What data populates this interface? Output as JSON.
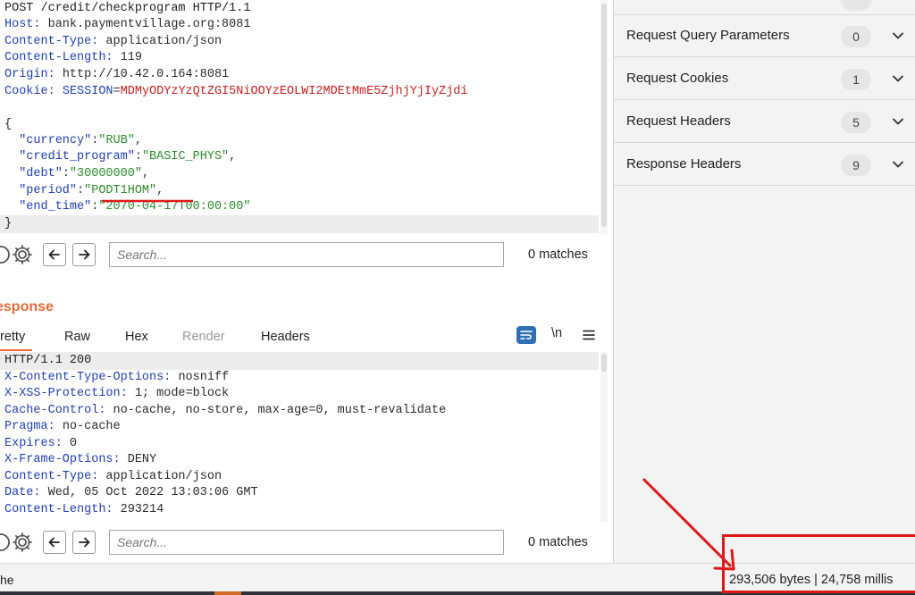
{
  "request": {
    "request_line": "POST /credit/checkprogram HTTP/1.1",
    "headers": [
      {
        "name": "Host",
        "value": "bank.paymentvillage.org:8081"
      },
      {
        "name": "Content-Type",
        "value": "application/json"
      },
      {
        "name": "Content-Length",
        "value": "119"
      },
      {
        "name": "Origin",
        "value": "http://10.42.0.164:8081"
      }
    ],
    "cookie": {
      "name": "Cookie",
      "session_key": "SESSION",
      "session_value": "MDMyODYzYzQtZGI5NiOOYzEOLWI2MDEtMmE5ZjhjYjIyZjdi"
    },
    "body_open": "{",
    "body_fields": [
      {
        "key": "\"currency\"",
        "value": "\"RUB\"",
        "trail": ","
      },
      {
        "key": "\"credit_program\"",
        "value": "\"BASIC_PHYS\"",
        "trail": ","
      },
      {
        "key": "\"debt\"",
        "value": "\"30000000\"",
        "trail": ","
      },
      {
        "key": "\"period\"",
        "value": "\"PODT1HOM\"",
        "trail": ","
      },
      {
        "key": "\"end_time\"",
        "value": "\"2070-04-17T00:00:00\"",
        "trail": ""
      }
    ],
    "body_close": "}"
  },
  "request_search": {
    "placeholder": "Search...",
    "matches": "0 matches"
  },
  "response": {
    "title": "esponse",
    "tabs": [
      {
        "label": "retty"
      },
      {
        "label": "Raw"
      },
      {
        "label": "Hex"
      },
      {
        "label": "Render"
      },
      {
        "label": "Headers"
      }
    ],
    "newline_toggle": "\\n",
    "status_line": "HTTP/1.1 200",
    "headers": [
      {
        "name": "X-Content-Type-Options",
        "value": "nosniff"
      },
      {
        "name": "X-XSS-Protection",
        "value": "1; mode=block"
      },
      {
        "name": "Cache-Control",
        "value": "no-cache, no-store, max-age=0, must-revalidate"
      },
      {
        "name": "Pragma",
        "value": "no-cache"
      },
      {
        "name": "Expires",
        "value": "0"
      },
      {
        "name": "X-Frame-Options",
        "value": "DENY"
      },
      {
        "name": "Content-Type",
        "value": "application/json"
      },
      {
        "name": "Date",
        "value": "Wed, 05 Oct 2022 13:03:06 GMT"
      },
      {
        "name": "Content-Length",
        "value": "293214"
      }
    ]
  },
  "response_search": {
    "placeholder": "Search...",
    "matches": "0 matches"
  },
  "inspector": {
    "rows": [
      {
        "label": "Request Query Parameters",
        "count": "0"
      },
      {
        "label": "Request Cookies",
        "count": "1"
      },
      {
        "label": "Request Headers",
        "count": "5"
      },
      {
        "label": "Response Headers",
        "count": "9"
      }
    ]
  },
  "status_bar": {
    "left": "he",
    "right": "293,506 bytes | 24,758 millis"
  },
  "colors": {
    "accent": "#e8683a",
    "annotation": "#e01818",
    "header_key": "#1f3fb4",
    "string": "#2d8a2d",
    "cookie_value": "#c71e1e"
  }
}
